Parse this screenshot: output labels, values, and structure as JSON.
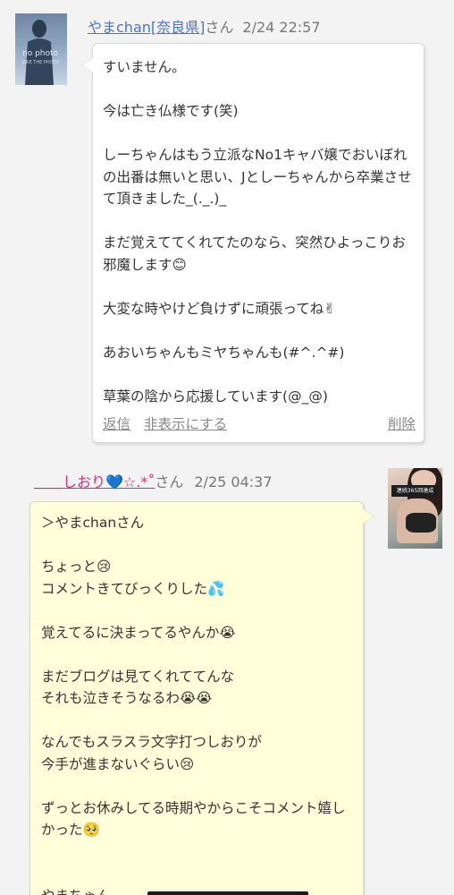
{
  "comment1": {
    "avatar": {
      "text": "no photo",
      "subtext": "LIKE THE PHOTO"
    },
    "author": "やまchan[奈良県]",
    "suffix": "さん",
    "date": "2/24 22:57",
    "lines": [
      "すいません。",
      "",
      "今は亡き仏様です(笑)",
      "",
      "しーちゃんはもう立派なNo1キャバ嬢でおいぼれの出番は無いと思い、Jとしーちゃんから卒業させて頂きました_(._.)_",
      "",
      "まだ覚えててくれてたのなら、突然ひよっこりお邪魔します😊",
      "",
      "大変な時やけど負けずに頑張ってね✌",
      "",
      "あおいちゃんもミヤちゃんも(#^.^#)",
      "",
      "草葉の陰から応援しています(@_@)"
    ],
    "actions": {
      "reply": "返信",
      "hide": "非表示にする",
      "delete": "削除"
    }
  },
  "comment2": {
    "author": "＿＿しおり💙☆.*˚",
    "suffix": "さん",
    "date": "2/25 04:37",
    "avatar_badge": "連続365回達成",
    "lines": [
      "＞やまchanさん",
      "",
      "ちょっと😢",
      "コメントきてびっくりした💦",
      "",
      "覚えてるに決まってるやんか😭",
      "",
      "まだブログは見てくれててんな",
      "それも泣きそうなるわ😭😭",
      "",
      "なんでもスラスラ文字打つしおりが",
      "今手が進まないぐらい😢",
      "",
      "ずっとお休みしてる時期やからこそコメント嬉しかった🥺",
      "",
      "",
      "やまちゃん"
    ]
  }
}
